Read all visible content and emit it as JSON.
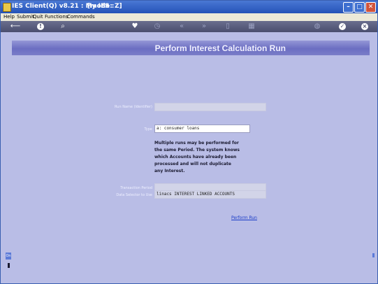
{
  "window": {
    "title": "IES Client(Q) v8.21 : My IES :",
    "mode": "[mode: Z]",
    "minimize_glyph": "–",
    "maximize_glyph": "□",
    "close_glyph": "✕"
  },
  "menubar": {
    "items": [
      "Help",
      "Submit",
      "Quit",
      "Functions",
      "Commands"
    ]
  },
  "toolbar": {
    "icons": [
      "back-arrow-icon",
      "info-icon",
      "search-icon",
      "heart-icon",
      "clock-icon",
      "rewind-icon",
      "fast-forward-icon",
      "copy-icon",
      "grid-icon",
      "globe-icon",
      "check-icon",
      "close-icon"
    ]
  },
  "page": {
    "title": "Perform Interest Calculation Run"
  },
  "form": {
    "run_name_label": "Run Name (Identifier)",
    "run_name_value": "",
    "type_label": "Type",
    "type_value": "a: consumer loans",
    "info_text_lines": [
      "Multiple runs may be performed for",
      "the same Period. The system knows",
      "which Accounts have already been",
      "processed and will not duplicate",
      "any Interest."
    ],
    "transaction_period_label": "Transaction Period",
    "transaction_period_value": "",
    "data_selector_label": "Data Selector to Use",
    "data_selector_value": "linacs INTEREST LINKED ACCOUNTS",
    "perform_run_link": "Perform Run"
  },
  "side": {
    "button_label": "On"
  },
  "colors": {
    "background": "#b9bde6",
    "banner": "#7a7dc8",
    "link": "#1a3cc8"
  }
}
